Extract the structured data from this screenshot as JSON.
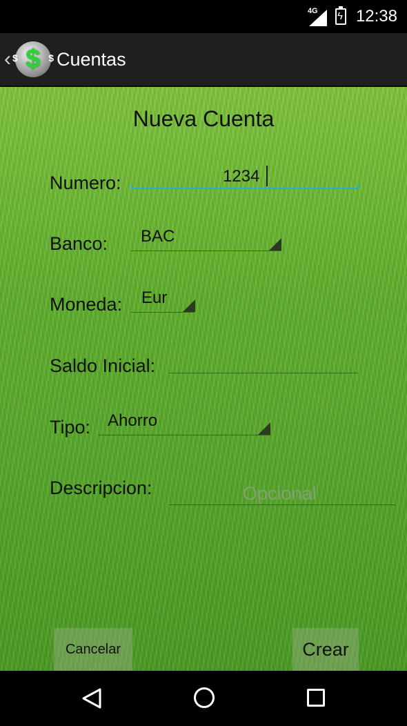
{
  "status_bar": {
    "network": "4G",
    "time": "12:38"
  },
  "action_bar": {
    "title": "Cuentas",
    "icon_symbol": "$",
    "icon_mini_symbol": "$"
  },
  "form": {
    "title": "Nueva Cuenta",
    "numero": {
      "label": "Numero:",
      "value": "1234"
    },
    "banco": {
      "label": "Banco:",
      "selected": "BAC"
    },
    "moneda": {
      "label": "Moneda:",
      "selected": "Eur"
    },
    "saldo_inicial": {
      "label": "Saldo Inicial:",
      "value": ""
    },
    "tipo": {
      "label": "Tipo:",
      "selected": "Ahorro"
    },
    "descripcion": {
      "label": "Descripcion:",
      "placeholder": "Opcional"
    }
  },
  "buttons": {
    "cancel": "Cancelar",
    "create": "Crear"
  },
  "colors": {
    "focus_accent": "#2fa8d8",
    "dollar_green": "#2fd52f",
    "action_bar_bg": "#1f1f1f"
  }
}
